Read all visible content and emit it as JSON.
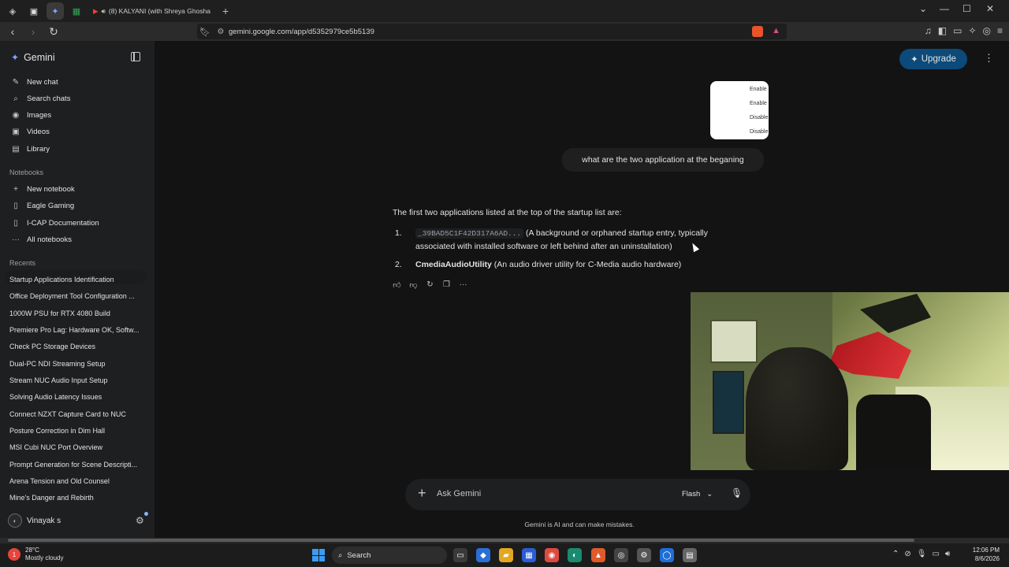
{
  "browser": {
    "tab_title": "(8) KALYANI (with Shreya Ghosha",
    "url": "gemini.google.com/app/d5352979ce5b5139"
  },
  "sidebar": {
    "brand": "Gemini",
    "nav": [
      {
        "label": "New chat",
        "icon": "edit-icon"
      },
      {
        "label": "Search chats",
        "icon": "search-icon"
      },
      {
        "label": "Images",
        "icon": "image-icon"
      },
      {
        "label": "Videos",
        "icon": "video-icon"
      },
      {
        "label": "Library",
        "icon": "library-icon"
      }
    ],
    "notebooks_label": "Notebooks",
    "notebooks": [
      {
        "label": "New notebook",
        "icon": "plus-icon"
      },
      {
        "label": "Eagle Gaming",
        "icon": "notebook-icon"
      },
      {
        "label": "I-CAP Documentation",
        "icon": "notebook-icon"
      },
      {
        "label": "All notebooks",
        "icon": "more-icon"
      }
    ],
    "recents_label": "Recents",
    "recents": [
      "Startup Applications Identification",
      "Office Deployment Tool Configuration ...",
      "1000W PSU for RTX 4080 Build",
      "Premiere Pro Lag: Hardware OK, Softw...",
      "Check PC Storage Devices",
      "Dual-PC NDI Streaming Setup",
      "Stream NUC Audio Input Setup",
      "Solving Audio Latency Issues",
      "Connect NZXT Capture Card to NUC",
      "Posture Correction in Dim Hall",
      "MSI Cubi NUC Port Overview",
      "Prompt Generation for Scene Descripti...",
      "Arena Tension and Old Counsel",
      "Mine's Danger and Rebirth"
    ],
    "user_name": "Vinayak s"
  },
  "header": {
    "upgrade_label": "Upgrade"
  },
  "chat": {
    "thumbnail_lines": [
      "Enable",
      "Enable",
      "Disable",
      "Disable"
    ],
    "user_message": "what are the two application at the beganing",
    "answer_intro": "The first two applications listed at the top of the startup list are:",
    "items": [
      {
        "num": "1.",
        "code": "_39BAD5C1F42D317A6AD...",
        "text_line1": "(A background or orphaned startup entry, typically",
        "text_line2": "associated with installed software or left behind after an uninstallation)"
      },
      {
        "num": "2.",
        "bold": "CmediaAudioUtility",
        "text": "(An audio driver utility for C-Media audio hardware)"
      }
    ]
  },
  "prompt": {
    "placeholder": "Ask Gemini",
    "model": "Flash",
    "disclaimer": "Gemini is AI and can make mistakes."
  },
  "taskbar": {
    "temp": "28°C",
    "weather": "Mostly cloudy",
    "search_label": "Search",
    "time": "12:06 PM",
    "date": "8/6/2026"
  },
  "colors": {
    "background": "#131314",
    "sidebar": "#1e1f20",
    "upgrade": "#0b4a7a",
    "accent": "#8ab4f8"
  }
}
